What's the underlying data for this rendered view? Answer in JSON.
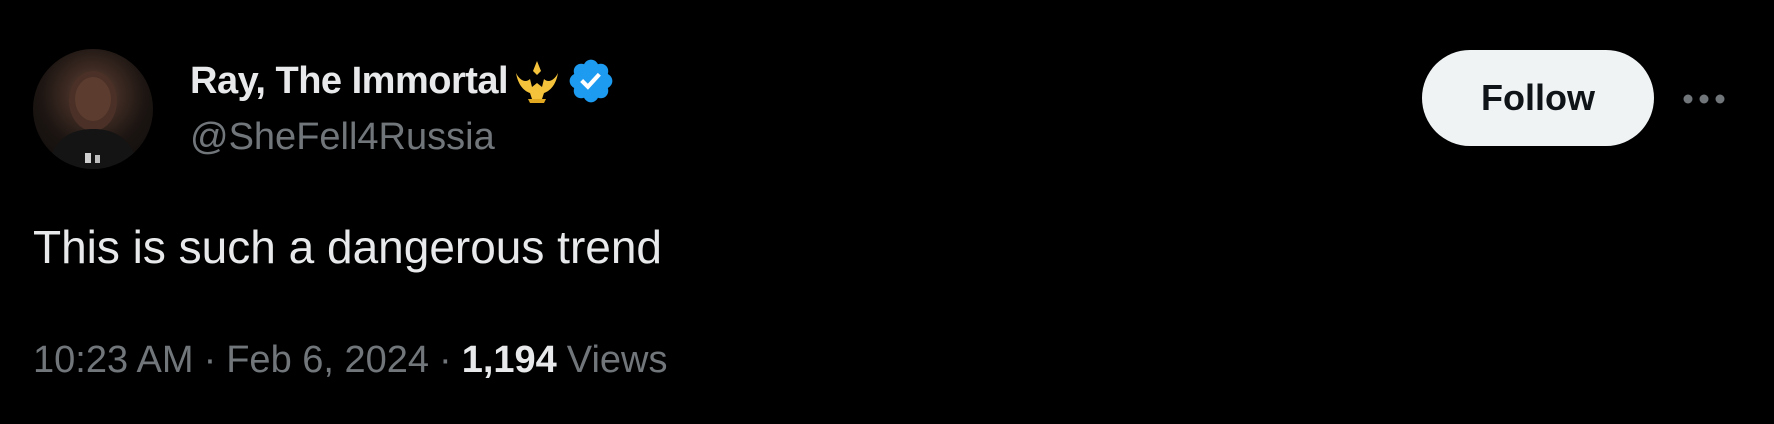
{
  "author": {
    "display_name": "Ray, The Immortal",
    "handle": "@SheFell4Russia",
    "verified": true,
    "name_emoji": "crown-icon",
    "verified_color": "#1d9bf0",
    "emoji_color": "#f5c33b"
  },
  "actions": {
    "follow_label": "Follow",
    "more_icon": "more-dots-icon"
  },
  "tweet": {
    "text": "This is such a dangerous trend"
  },
  "meta": {
    "time": "10:23 AM",
    "separator": "·",
    "date": "Feb 6, 2024",
    "views_count": "1,194",
    "views_label": "Views"
  },
  "colors": {
    "background": "#000000",
    "primary_text": "#e7e9ea",
    "secondary_text": "#71767b",
    "follow_bg": "#eff3f4",
    "follow_text": "#0f1419"
  }
}
